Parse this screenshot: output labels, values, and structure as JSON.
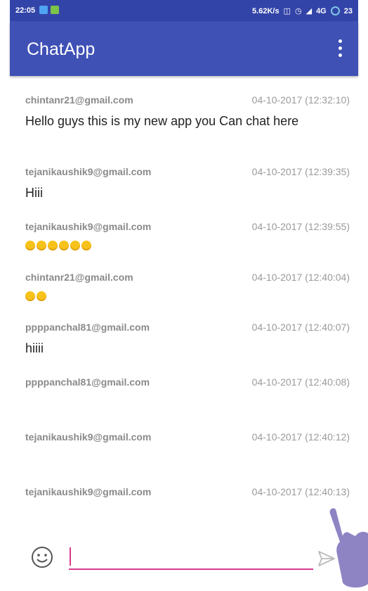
{
  "status_bar": {
    "time": "22:05",
    "net_speed": "5.62K/s",
    "network": "4G",
    "battery": "23"
  },
  "app_bar": {
    "title": "ChatApp",
    "overflow_icon": "more-vert-icon"
  },
  "messages": [
    {
      "sender": "chintanr21@gmail.com",
      "time": "04-10-2017 (12:32:10)",
      "text": "Hello guys this is my new app you  Can chat here"
    },
    {
      "sender": "tejanikaushik9@gmail.com",
      "time": "04-10-2017 (12:39:35)",
      "text": "Hiii"
    },
    {
      "sender": "tejanikaushik9@gmail.com",
      "time": "04-10-2017 (12:39:55)",
      "emoji_count": 6
    },
    {
      "sender": "chintanr21@gmail.com",
      "time": "04-10-2017 (12:40:04)",
      "emoji_count": 2
    },
    {
      "sender": "ppppanchal81@gmail.com",
      "time": "04-10-2017 (12:40:07)",
      "text": "hiiii"
    },
    {
      "sender": "ppppanchal81@gmail.com",
      "time": "04-10-2017 (12:40:08)"
    },
    {
      "sender": "tejanikaushik9@gmail.com",
      "time": "04-10-2017 (12:40:12)"
    },
    {
      "sender": "tejanikaushik9@gmail.com",
      "time": "04-10-2017 (12:40:13)"
    }
  ],
  "composer": {
    "input_value": "",
    "emoji_icon": "smiley-icon",
    "send_icon": "send-icon"
  },
  "colors": {
    "primary": "#3f51b5",
    "status_bar": "#3344a8",
    "input_accent": "#d63a8e",
    "emoji": "#f7c21a"
  }
}
